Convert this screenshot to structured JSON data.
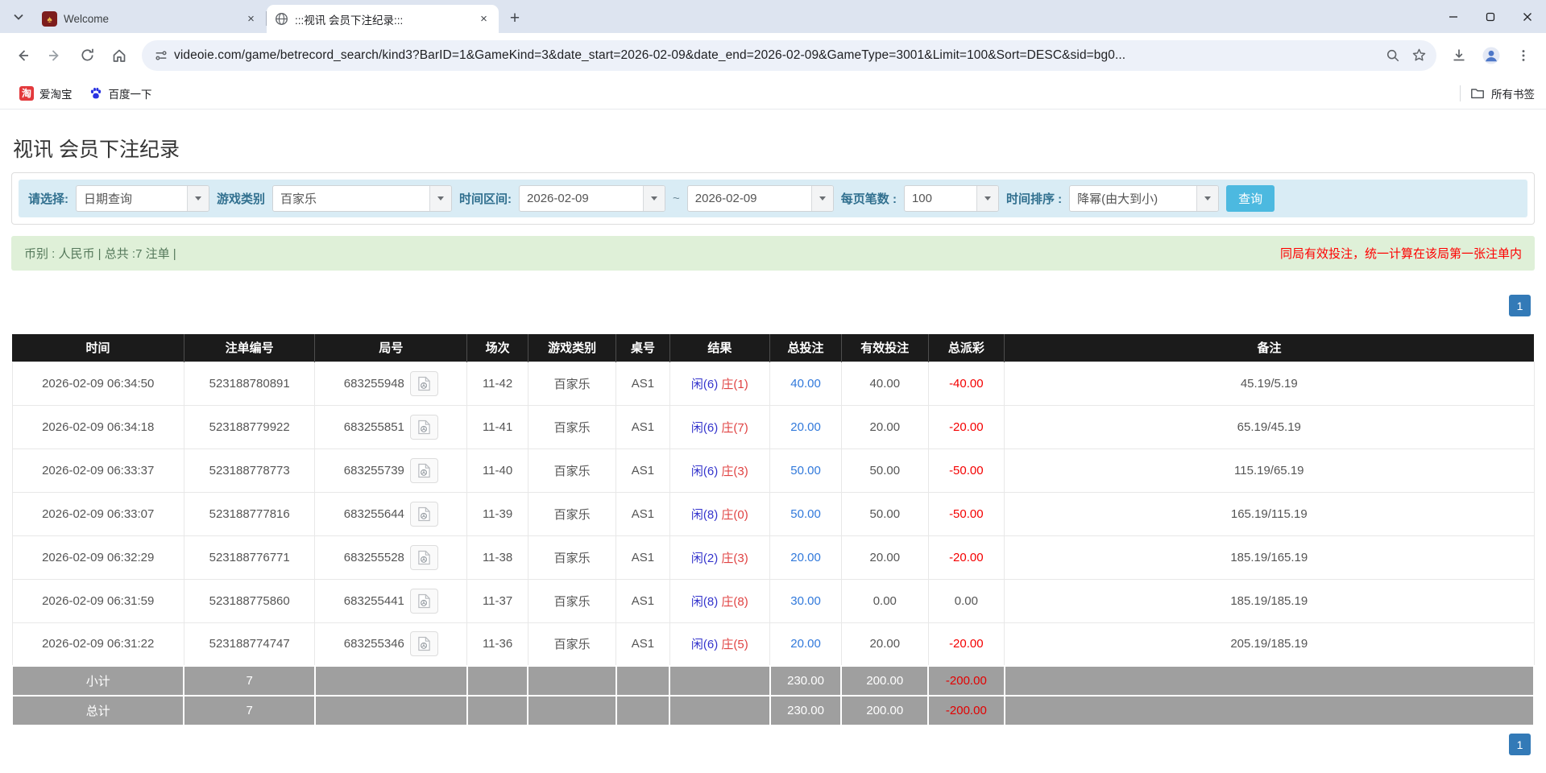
{
  "browser": {
    "tabs": [
      {
        "title": "Welcome",
        "active": false
      },
      {
        "title": ":::视讯 会员下注纪录:::",
        "active": true
      }
    ],
    "url": "videoie.com/game/betrecord_search/kind3?BarID=1&GameKind=3&date_start=2026-02-09&date_end=2026-02-09&GameType=3001&Limit=100&Sort=DESC&sid=bg0...",
    "bookmarks": [
      {
        "label": "爱淘宝"
      },
      {
        "label": "百度一下"
      }
    ],
    "all_bookmarks_label": "所有书签"
  },
  "page": {
    "title": "视讯 会员下注纪录",
    "filters": {
      "select_label": "请选择:",
      "select_value": "日期查询",
      "game_kind_label": "游戏类别",
      "game_kind_value": "百家乐",
      "date_range_label": "时间区间:",
      "date_start": "2026-02-09",
      "date_separator": "~",
      "date_end": "2026-02-09",
      "page_size_label": "每页笔数 :",
      "page_size_value": "100",
      "sort_label": "时间排序 :",
      "sort_value": "降幂(由大到小)",
      "search_button": "查询"
    },
    "summary": {
      "left": "币别 : 人民币 | 总共 :7 注单 |",
      "right": "同局有效投注，统一计算在该局第一张注单内"
    },
    "pagination": {
      "current_page": "1"
    },
    "table": {
      "headers": [
        "时间",
        "注单编号",
        "局号",
        "场次",
        "游戏类别",
        "桌号",
        "结果",
        "总投注",
        "有效投注",
        "总派彩",
        "备注"
      ],
      "rows": [
        {
          "time": "2026-02-09 06:34:50",
          "bet_id": "523188780891",
          "round_id": "683255948",
          "session": "11-42",
          "game": "百家乐",
          "table_no": "AS1",
          "result_p": "闲(6)",
          "result_b": "庄(1)",
          "total_bet": "40.00",
          "valid_bet": "40.00",
          "payout": "-40.00",
          "remark": "45.19/5.19"
        },
        {
          "time": "2026-02-09 06:34:18",
          "bet_id": "523188779922",
          "round_id": "683255851",
          "session": "11-41",
          "game": "百家乐",
          "table_no": "AS1",
          "result_p": "闲(6)",
          "result_b": "庄(7)",
          "total_bet": "20.00",
          "valid_bet": "20.00",
          "payout": "-20.00",
          "remark": "65.19/45.19"
        },
        {
          "time": "2026-02-09 06:33:37",
          "bet_id": "523188778773",
          "round_id": "683255739",
          "session": "11-40",
          "game": "百家乐",
          "table_no": "AS1",
          "result_p": "闲(6)",
          "result_b": "庄(3)",
          "total_bet": "50.00",
          "valid_bet": "50.00",
          "payout": "-50.00",
          "remark": "115.19/65.19"
        },
        {
          "time": "2026-02-09 06:33:07",
          "bet_id": "523188777816",
          "round_id": "683255644",
          "session": "11-39",
          "game": "百家乐",
          "table_no": "AS1",
          "result_p": "闲(8)",
          "result_b": "庄(0)",
          "total_bet": "50.00",
          "valid_bet": "50.00",
          "payout": "-50.00",
          "remark": "165.19/115.19"
        },
        {
          "time": "2026-02-09 06:32:29",
          "bet_id": "523188776771",
          "round_id": "683255528",
          "session": "11-38",
          "game": "百家乐",
          "table_no": "AS1",
          "result_p": "闲(2)",
          "result_b": "庄(3)",
          "total_bet": "20.00",
          "valid_bet": "20.00",
          "payout": "-20.00",
          "remark": "185.19/165.19"
        },
        {
          "time": "2026-02-09 06:31:59",
          "bet_id": "523188775860",
          "round_id": "683255441",
          "session": "11-37",
          "game": "百家乐",
          "table_no": "AS1",
          "result_p": "闲(8)",
          "result_b": "庄(8)",
          "total_bet": "30.00",
          "valid_bet": "0.00",
          "payout": "0.00",
          "remark": "185.19/185.19"
        },
        {
          "time": "2026-02-09 06:31:22",
          "bet_id": "523188774747",
          "round_id": "683255346",
          "session": "11-36",
          "game": "百家乐",
          "table_no": "AS1",
          "result_p": "闲(6)",
          "result_b": "庄(5)",
          "total_bet": "20.00",
          "valid_bet": "20.00",
          "payout": "-20.00",
          "remark": "205.19/185.19"
        }
      ],
      "subtotal": {
        "label": "小计",
        "count": "7",
        "total_bet": "230.00",
        "valid_bet": "200.00",
        "payout": "-200.00"
      },
      "total": {
        "label": "总计",
        "count": "7",
        "total_bet": "230.00",
        "valid_bet": "200.00",
        "payout": "-200.00"
      }
    }
  },
  "colors": {
    "table_header_bg": "#1b1b1b",
    "footer_row_bg": "#9f9f9f",
    "filter_bar_bg": "#d9ecf5",
    "filter_label": "#31708f",
    "summary_bg": "#dff0d8",
    "warning_red": "#fe0000",
    "link_blue": "#3179db",
    "player_blue": "#3333cc",
    "banker_red": "#e04343",
    "search_button": "#4cb9e0",
    "pagination_blue": "#337ab7",
    "tabstrip_bg": "#dde4f0"
  }
}
